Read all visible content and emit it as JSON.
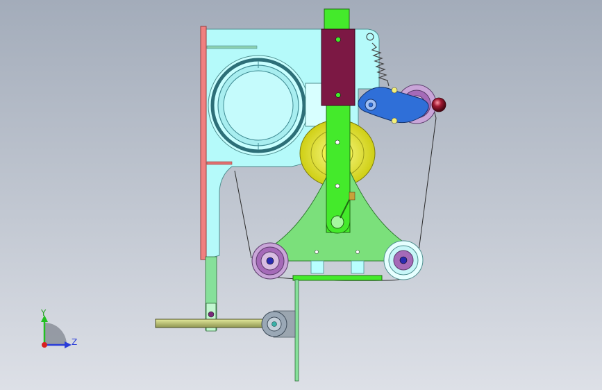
{
  "triad": {
    "y_label": "Y",
    "z_label": "Z"
  },
  "colors": {
    "housing": "#b5fafa",
    "housing_light": "#d6ffff",
    "housing_edge": "#5fa3a3",
    "bore_ring": "#3c7f86",
    "flange_plate": "#f08080",
    "slider_block": "#7c1844",
    "guide_bar": "#44ea2b",
    "triangle_plate": "#7be07b",
    "yellow_pulley": "#ecec2e",
    "purple_roller": "#a56ab8",
    "cyan_roller": "#d8ffff",
    "lever_arm": "#2f6fd8",
    "knob": "#8a1326",
    "spring": "#555555",
    "shaft": "#c0c77a",
    "support_rod": "#86e09a"
  }
}
